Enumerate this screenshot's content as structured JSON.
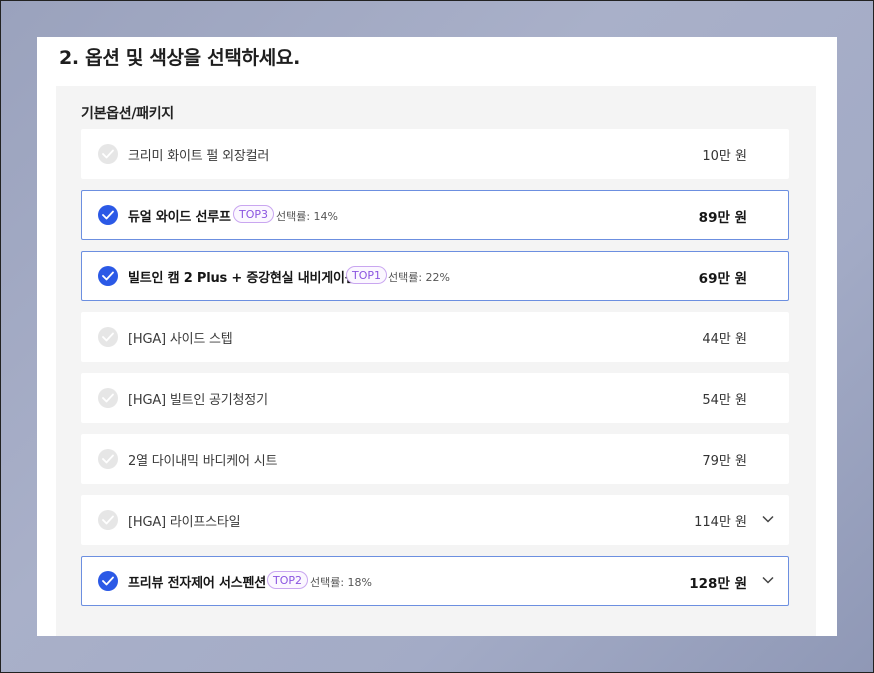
{
  "section": {
    "title": "2. 옵션 및 색상을 선택하세요.",
    "group_title": "기본옵션/패키지"
  },
  "options": [
    {
      "label": "크리미 화이트 펄 외장컬러",
      "price": "10만 원",
      "selected": false
    },
    {
      "label": "듀얼 와이드 선루프",
      "price": "89만 원",
      "selected": true,
      "badge": "TOP3",
      "rate": "선택률: 14%"
    },
    {
      "label": "빌트인 캠 2 Plus + 증강현실 내비게이션",
      "price": "69만 원",
      "selected": true,
      "badge": "TOP1",
      "rate": "선택률: 22%"
    },
    {
      "label": "[HGA] 사이드 스텝",
      "price": "44만 원",
      "selected": false
    },
    {
      "label": "[HGA] 빌트인 공기청정기",
      "price": "54만 원",
      "selected": false
    },
    {
      "label": "2열 다이내믹 바디케어 시트",
      "price": "79만 원",
      "selected": false
    },
    {
      "label": "[HGA] 라이프스타일",
      "price": "114만 원",
      "selected": false,
      "expandable": true
    },
    {
      "label": "프리뷰 전자제어 서스펜션",
      "price": "128만 원",
      "selected": true,
      "badge": "TOP2",
      "rate": "선택률: 18%",
      "expandable": true
    }
  ],
  "icons": {
    "check": "check-icon",
    "expand": "chevron-down-icon"
  },
  "colors": {
    "accent": "#2b59e6",
    "selected_border": "#6c8fe0",
    "badge": "#8b55e0"
  }
}
